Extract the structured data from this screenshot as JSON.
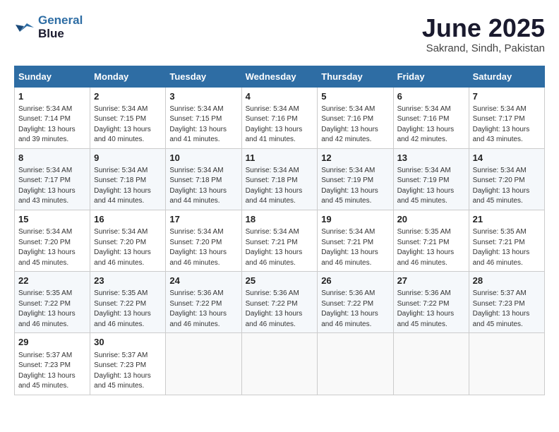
{
  "header": {
    "logo_line1": "General",
    "logo_line2": "Blue",
    "month_title": "June 2025",
    "subtitle": "Sakrand, Sindh, Pakistan"
  },
  "columns": [
    "Sunday",
    "Monday",
    "Tuesday",
    "Wednesday",
    "Thursday",
    "Friday",
    "Saturday"
  ],
  "weeks": [
    [
      {
        "day": "1",
        "info": "Sunrise: 5:34 AM\nSunset: 7:14 PM\nDaylight: 13 hours\nand 39 minutes."
      },
      {
        "day": "2",
        "info": "Sunrise: 5:34 AM\nSunset: 7:15 PM\nDaylight: 13 hours\nand 40 minutes."
      },
      {
        "day": "3",
        "info": "Sunrise: 5:34 AM\nSunset: 7:15 PM\nDaylight: 13 hours\nand 41 minutes."
      },
      {
        "day": "4",
        "info": "Sunrise: 5:34 AM\nSunset: 7:16 PM\nDaylight: 13 hours\nand 41 minutes."
      },
      {
        "day": "5",
        "info": "Sunrise: 5:34 AM\nSunset: 7:16 PM\nDaylight: 13 hours\nand 42 minutes."
      },
      {
        "day": "6",
        "info": "Sunrise: 5:34 AM\nSunset: 7:16 PM\nDaylight: 13 hours\nand 42 minutes."
      },
      {
        "day": "7",
        "info": "Sunrise: 5:34 AM\nSunset: 7:17 PM\nDaylight: 13 hours\nand 43 minutes."
      }
    ],
    [
      {
        "day": "8",
        "info": "Sunrise: 5:34 AM\nSunset: 7:17 PM\nDaylight: 13 hours\nand 43 minutes."
      },
      {
        "day": "9",
        "info": "Sunrise: 5:34 AM\nSunset: 7:18 PM\nDaylight: 13 hours\nand 44 minutes."
      },
      {
        "day": "10",
        "info": "Sunrise: 5:34 AM\nSunset: 7:18 PM\nDaylight: 13 hours\nand 44 minutes."
      },
      {
        "day": "11",
        "info": "Sunrise: 5:34 AM\nSunset: 7:18 PM\nDaylight: 13 hours\nand 44 minutes."
      },
      {
        "day": "12",
        "info": "Sunrise: 5:34 AM\nSunset: 7:19 PM\nDaylight: 13 hours\nand 45 minutes."
      },
      {
        "day": "13",
        "info": "Sunrise: 5:34 AM\nSunset: 7:19 PM\nDaylight: 13 hours\nand 45 minutes."
      },
      {
        "day": "14",
        "info": "Sunrise: 5:34 AM\nSunset: 7:20 PM\nDaylight: 13 hours\nand 45 minutes."
      }
    ],
    [
      {
        "day": "15",
        "info": "Sunrise: 5:34 AM\nSunset: 7:20 PM\nDaylight: 13 hours\nand 45 minutes."
      },
      {
        "day": "16",
        "info": "Sunrise: 5:34 AM\nSunset: 7:20 PM\nDaylight: 13 hours\nand 46 minutes."
      },
      {
        "day": "17",
        "info": "Sunrise: 5:34 AM\nSunset: 7:20 PM\nDaylight: 13 hours\nand 46 minutes."
      },
      {
        "day": "18",
        "info": "Sunrise: 5:34 AM\nSunset: 7:21 PM\nDaylight: 13 hours\nand 46 minutes."
      },
      {
        "day": "19",
        "info": "Sunrise: 5:34 AM\nSunset: 7:21 PM\nDaylight: 13 hours\nand 46 minutes."
      },
      {
        "day": "20",
        "info": "Sunrise: 5:35 AM\nSunset: 7:21 PM\nDaylight: 13 hours\nand 46 minutes."
      },
      {
        "day": "21",
        "info": "Sunrise: 5:35 AM\nSunset: 7:21 PM\nDaylight: 13 hours\nand 46 minutes."
      }
    ],
    [
      {
        "day": "22",
        "info": "Sunrise: 5:35 AM\nSunset: 7:22 PM\nDaylight: 13 hours\nand 46 minutes."
      },
      {
        "day": "23",
        "info": "Sunrise: 5:35 AM\nSunset: 7:22 PM\nDaylight: 13 hours\nand 46 minutes."
      },
      {
        "day": "24",
        "info": "Sunrise: 5:36 AM\nSunset: 7:22 PM\nDaylight: 13 hours\nand 46 minutes."
      },
      {
        "day": "25",
        "info": "Sunrise: 5:36 AM\nSunset: 7:22 PM\nDaylight: 13 hours\nand 46 minutes."
      },
      {
        "day": "26",
        "info": "Sunrise: 5:36 AM\nSunset: 7:22 PM\nDaylight: 13 hours\nand 46 minutes."
      },
      {
        "day": "27",
        "info": "Sunrise: 5:36 AM\nSunset: 7:22 PM\nDaylight: 13 hours\nand 45 minutes."
      },
      {
        "day": "28",
        "info": "Sunrise: 5:37 AM\nSunset: 7:23 PM\nDaylight: 13 hours\nand 45 minutes."
      }
    ],
    [
      {
        "day": "29",
        "info": "Sunrise: 5:37 AM\nSunset: 7:23 PM\nDaylight: 13 hours\nand 45 minutes."
      },
      {
        "day": "30",
        "info": "Sunrise: 5:37 AM\nSunset: 7:23 PM\nDaylight: 13 hours\nand 45 minutes."
      },
      {
        "day": "",
        "info": ""
      },
      {
        "day": "",
        "info": ""
      },
      {
        "day": "",
        "info": ""
      },
      {
        "day": "",
        "info": ""
      },
      {
        "day": "",
        "info": ""
      }
    ]
  ]
}
